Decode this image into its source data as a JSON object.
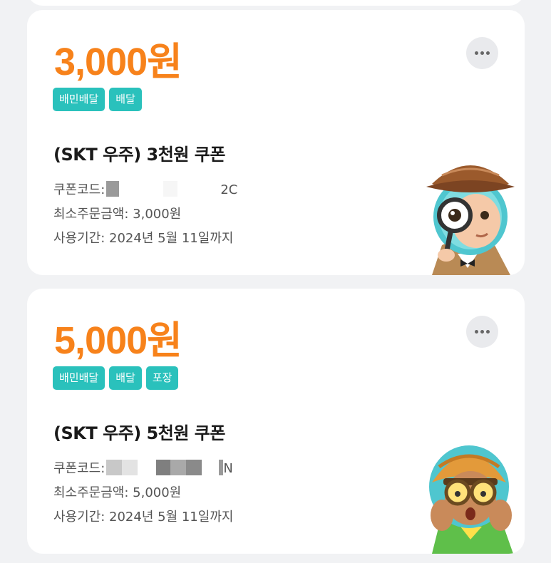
{
  "coupons": [
    {
      "amount": "3,000원",
      "tags": [
        "배민배달",
        "배달"
      ],
      "title": "(SKT 우주) 3천원 쿠폰",
      "code_label": "쿠폰코드:",
      "code_tail": "2C",
      "min_order": "최소주문금액: 3,000원",
      "expiry": "사용기간: 2024년 5월 11일까지",
      "more_icon": "more-horizontal-icon",
      "character": "detective-character-illustration"
    },
    {
      "amount": "5,000원",
      "tags": [
        "배민배달",
        "배달",
        "포장"
      ],
      "title": "(SKT 우주) 5천원 쿠폰",
      "code_label": "쿠폰코드:",
      "code_tail": "N",
      "min_order": "최소주문금액: 5,000원",
      "expiry": "사용기간: 2024년 5월 11일까지",
      "more_icon": "more-horizontal-icon",
      "character": "goggles-character-illustration"
    }
  ],
  "colors": {
    "amount": "#f7821b",
    "tag_bg": "#2ac1bc",
    "page_bg": "#f1f2f4",
    "card_bg": "#ffffff"
  }
}
